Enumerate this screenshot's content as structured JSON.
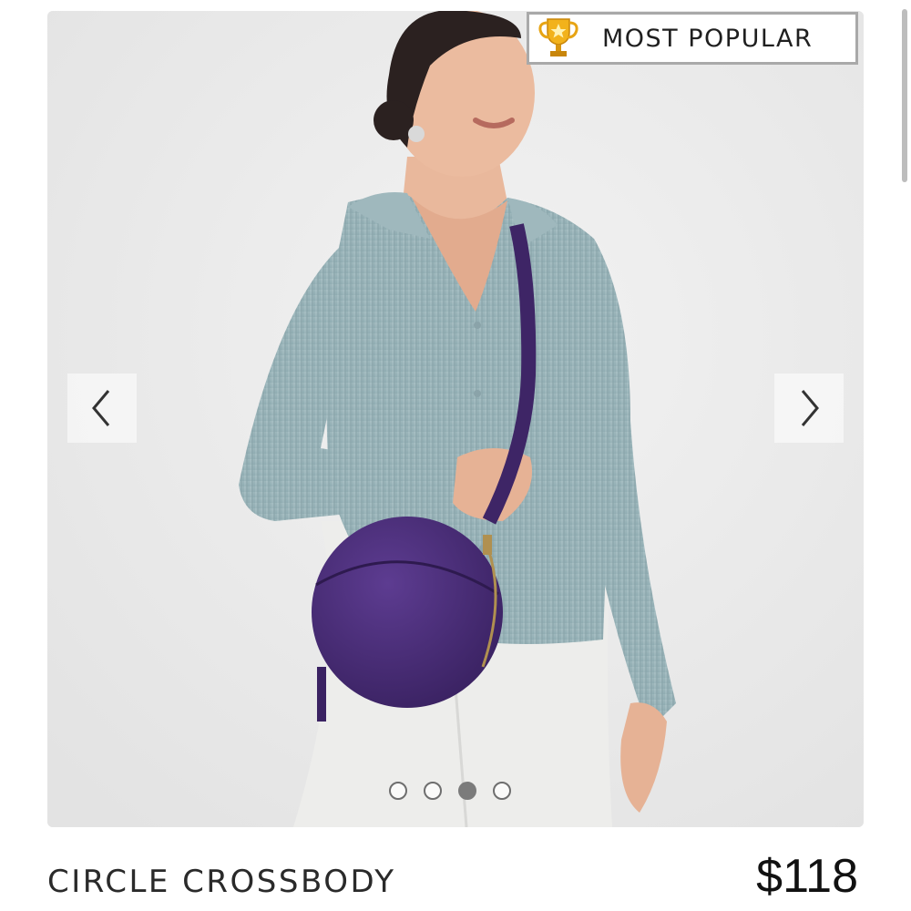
{
  "badge": {
    "label": "MOST POPULAR",
    "icon": "trophy-icon"
  },
  "gallery": {
    "prev_icon": "chevron-left-icon",
    "next_icon": "chevron-right-icon",
    "image_count": 4,
    "active_index": 2
  },
  "product": {
    "title": "CIRCLE CROSSBODY",
    "price": "$118"
  },
  "colors": {
    "image_background": "#ececec",
    "bag": "#4b2e7a",
    "sweater": "#9fb8bd",
    "badge_border": "#a9a9a9"
  }
}
